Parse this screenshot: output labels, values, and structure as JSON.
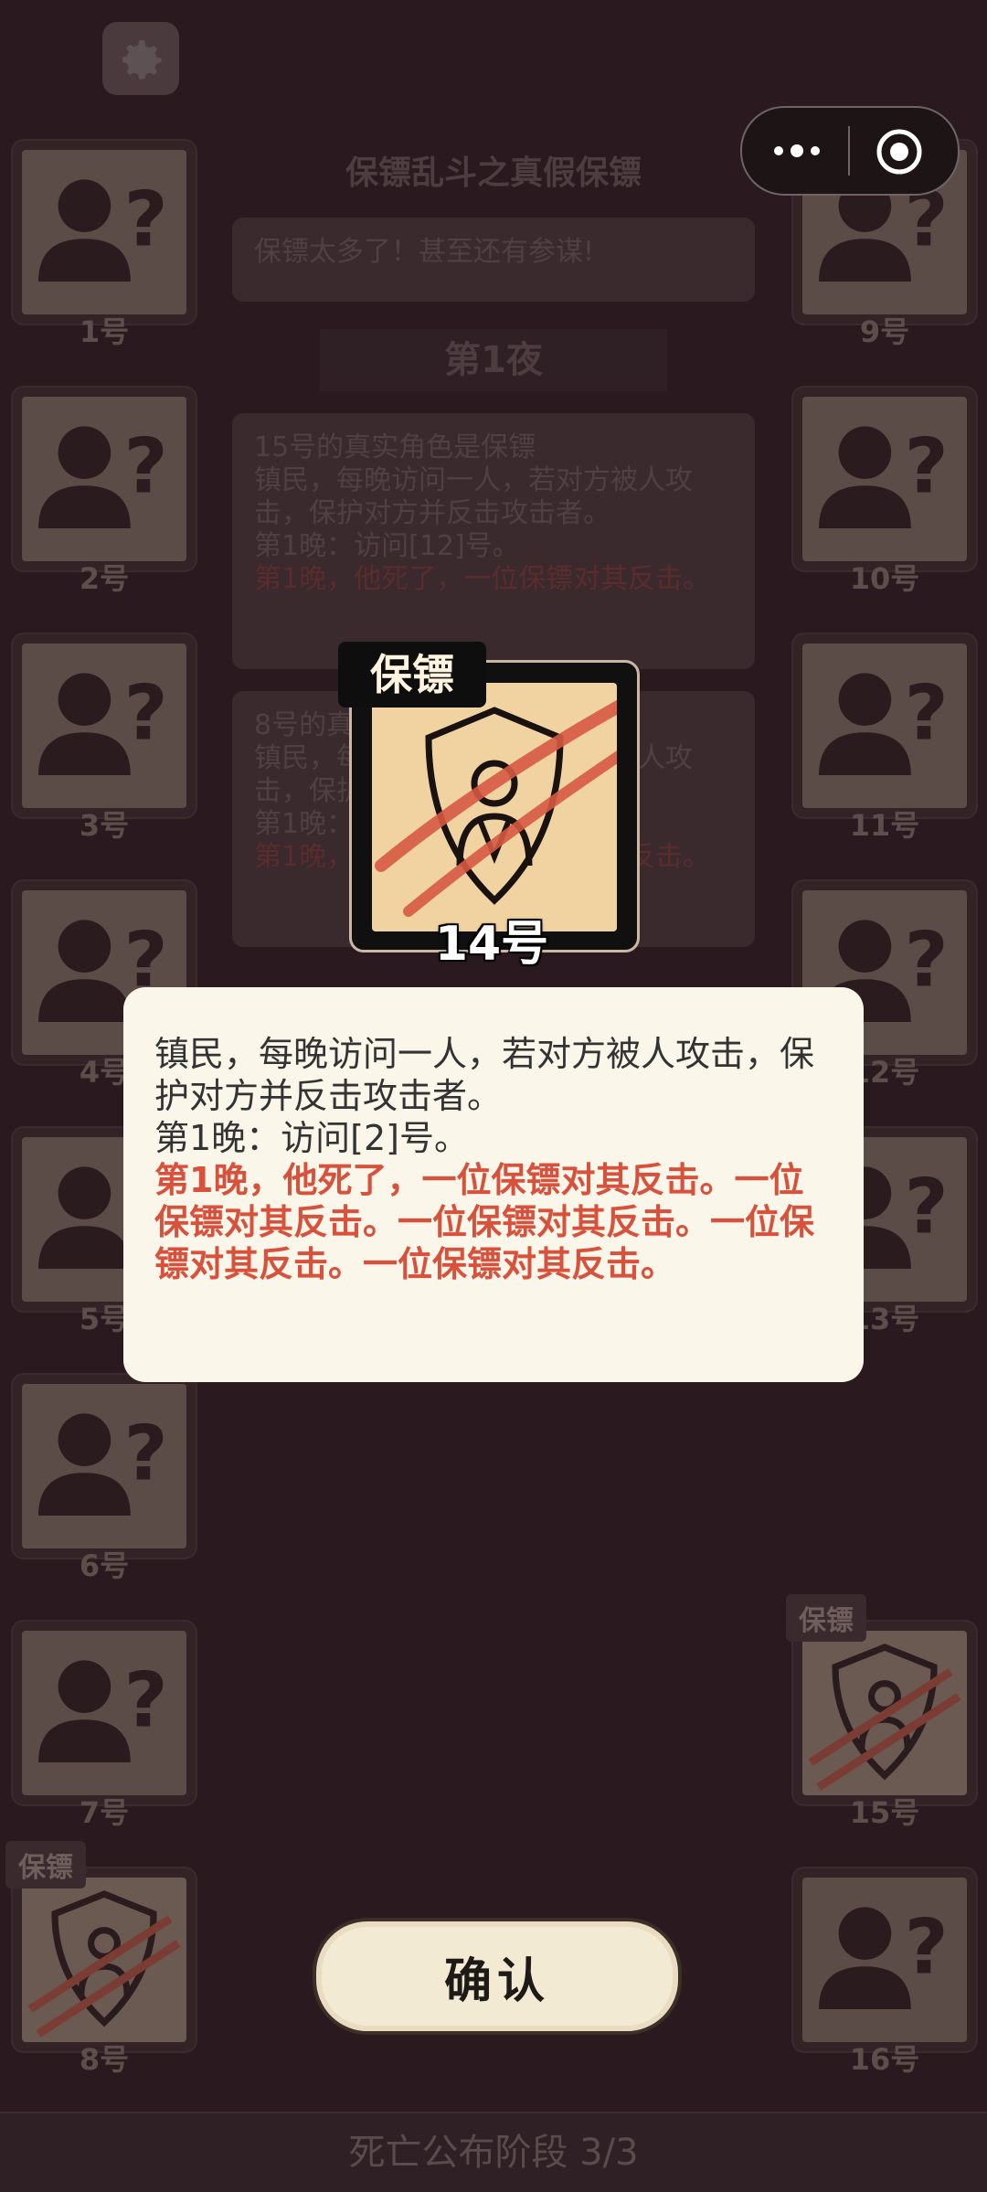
{
  "game_title": "保镖乱斗之真假保镖",
  "subtitle": "保镖太多了！甚至还有参谋!",
  "night_label": "第1夜",
  "log_entries": [
    {
      "title": "15号的真实角色是保镖",
      "desc": "镇民，每晚访问一人，若对方被人攻击，保护对方并反击攻击者。",
      "visit": "第1晚：访问[12]号。",
      "death": "第1晚，他死了，一位保镖对其反击。"
    },
    {
      "title": "8号的真实角色是保镖",
      "desc": "镇民，每晚访问一人，若对方被人攻击，保护对方并反击攻击者。",
      "visit": "第1晚：访问[?]号。",
      "death": "第1晚，他死了，一位保镖对其反击。"
    }
  ],
  "players_left": [
    {
      "num": "1号"
    },
    {
      "num": "2号"
    },
    {
      "num": "3号"
    },
    {
      "num": "4号"
    },
    {
      "num": "5号"
    },
    {
      "num": "6号"
    },
    {
      "num": "7号"
    },
    {
      "num": "8号",
      "tag": "保镖"
    }
  ],
  "players_right": [
    {
      "num": "9号"
    },
    {
      "num": "10号"
    },
    {
      "num": "11号"
    },
    {
      "num": "12号"
    },
    {
      "num": "13号"
    },
    {
      "num": "",
      "hidden": true
    },
    {
      "num": "15号",
      "tag": "保镖"
    },
    {
      "num": "16号"
    }
  ],
  "focused": {
    "role": "保镖",
    "number": "14号",
    "desc": "镇民，每晚访问一人，若对方被人攻击，保护对方并反击攻击者。",
    "visit": "第1晚：访问[2]号。",
    "death": "第1晚，他死了，一位保镖对其反击。一位保镖对其反击。一位保镖对其反击。一位保镖对其反击。一位保镖对其反击。"
  },
  "confirm_label": "确认",
  "phase_label": "死亡公布阶段 3/3",
  "colors": {
    "background": "#2a1a1f",
    "dialog": "#faf7ea",
    "death_text": "#d8513c",
    "card_art": "#f1d3a1"
  },
  "icons": {
    "settings": "gear-icon",
    "menu": "more-dots-icon",
    "close": "target-icon",
    "unknown_player": "unknown-person-icon",
    "role": "shield-person-icon"
  }
}
